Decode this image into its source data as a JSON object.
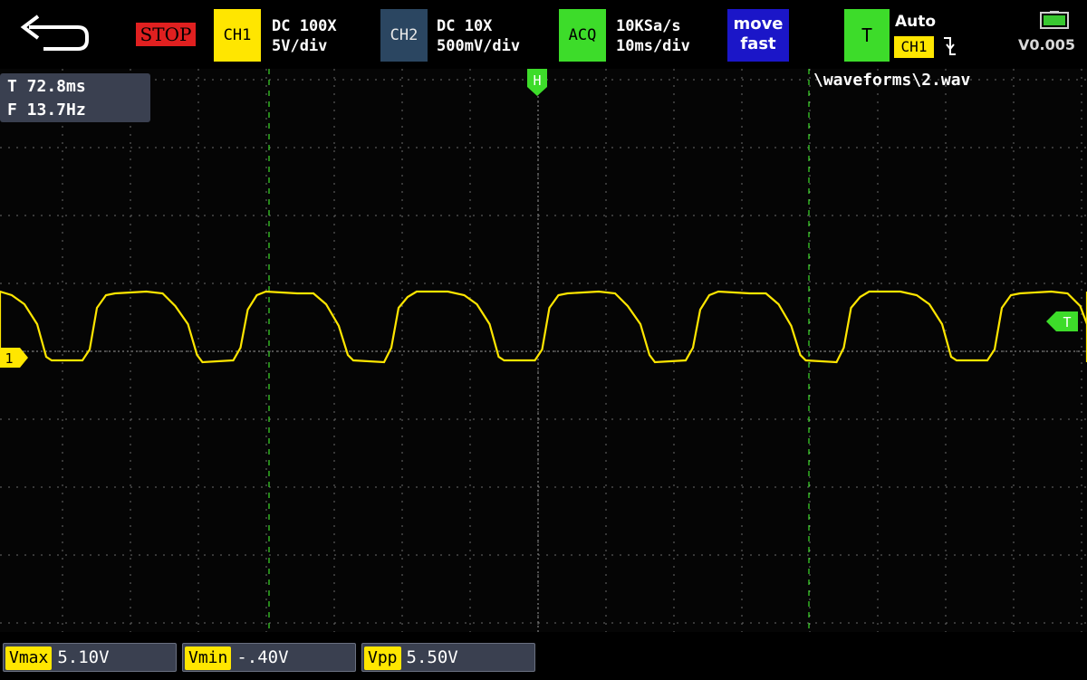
{
  "toolbar": {
    "stop_label": "STOP",
    "ch1": {
      "tag": "CH1",
      "coupling": "DC 100X",
      "scale": "5V/div"
    },
    "ch2": {
      "tag": "CH2",
      "coupling": "DC 10X",
      "scale": "500mV/div"
    },
    "acq": {
      "tag": "ACQ",
      "sample_rate": "10KSa/s",
      "timebase": "10ms/div"
    },
    "move": {
      "line1": "move",
      "line2": "fast"
    },
    "trigger": {
      "tag": "T",
      "mode": "Auto",
      "source": "CH1"
    },
    "version": "V0.005"
  },
  "screen": {
    "readout": {
      "period": "T 72.8ms",
      "frequency": "F 13.7Hz"
    },
    "file_path": "\\waveforms\\2.wav",
    "horizontal_marker": "H",
    "ch1_marker": "1",
    "trigger_marker": "T"
  },
  "measurements": [
    {
      "label": "Vmax",
      "value": "5.10V"
    },
    {
      "label": "Vmin",
      "value": "-.40V"
    },
    {
      "label": "Vpp",
      "value": "5.50V"
    }
  ],
  "colors": {
    "ch1": "#ffe600",
    "stop": "#e02020",
    "acq": "#3ddc2a",
    "move": "#1b16c8",
    "ch2": "#2b4661",
    "cursor": "#3ddc2a"
  },
  "icons": {
    "back": "back-arrow-icon",
    "battery": "battery-icon",
    "edge": "falling-edge-icon"
  }
}
